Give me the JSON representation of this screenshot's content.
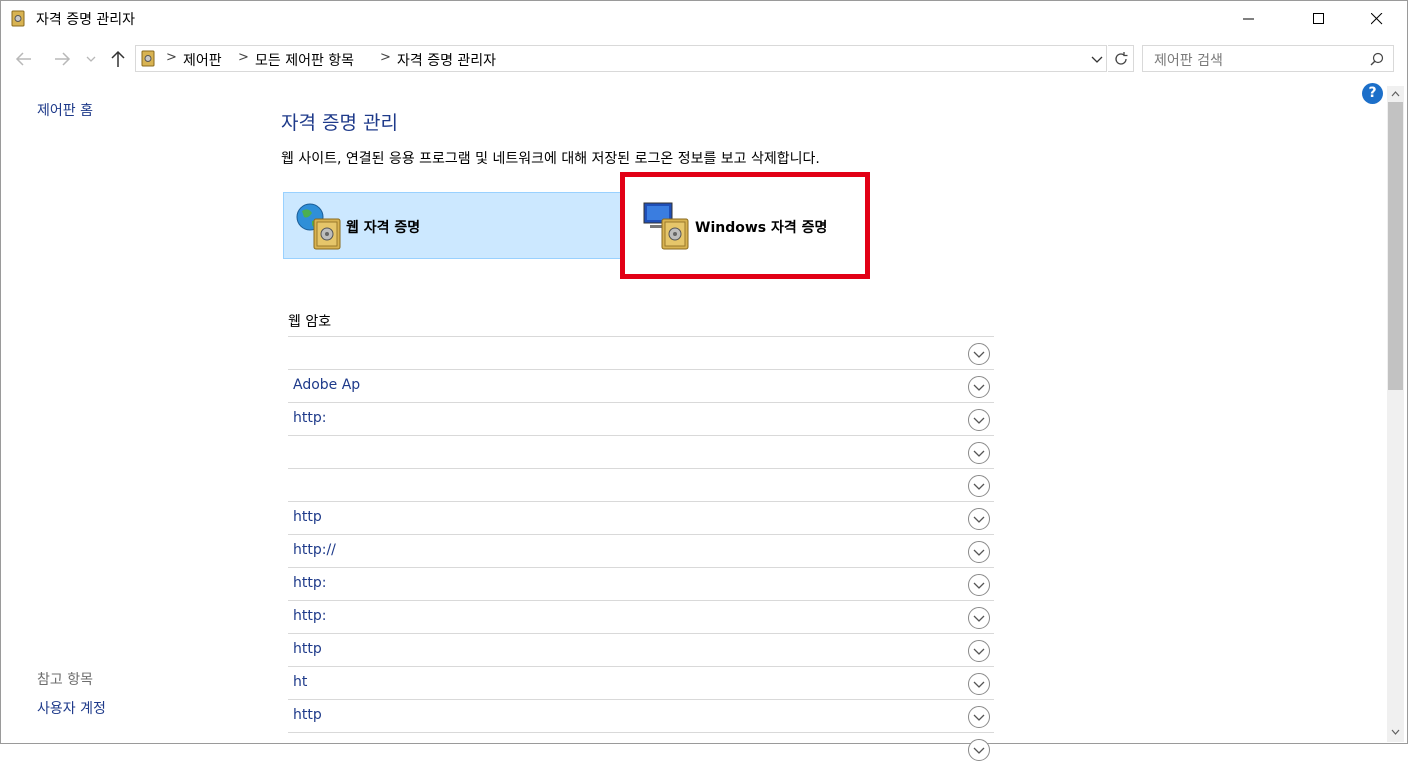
{
  "window": {
    "title": "자격 증명 관리자"
  },
  "address": {
    "breadcrumbs": [
      "제어판",
      "모든 제어판 항목",
      "자격 증명 관리자"
    ],
    "search_placeholder": "제어판 검색"
  },
  "left": {
    "home_link": "제어판 홈",
    "see_also_heading": "참고 항목",
    "user_accounts_link": "사용자 계정"
  },
  "main": {
    "title": "자격 증명 관리",
    "description": "웹 사이트, 연결된 응용 프로그램 및 네트워크에 대해 저장된 로그온 정보를 보고 삭제합니다.",
    "tiles": [
      {
        "label": "웹 자격 증명",
        "selected": true
      },
      {
        "label": "Windows 자격 증명",
        "selected": false
      }
    ],
    "section_label": "웹 암호",
    "entries": [
      "",
      "Adobe Ap",
      "http:",
      "",
      "",
      "http",
      "http://",
      "http:",
      "http:",
      "http",
      "ht",
      "http",
      ""
    ]
  },
  "help": {
    "label": "?"
  },
  "colors": {
    "link": "#1e3a8a",
    "selected_tile": "#cce8ff",
    "highlight": "#e20015"
  }
}
